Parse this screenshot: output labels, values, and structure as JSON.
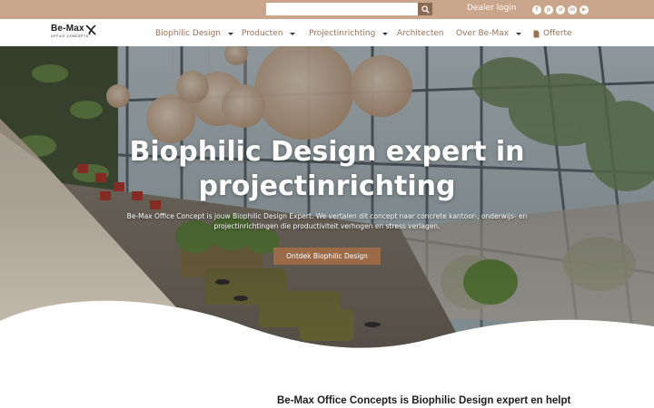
{
  "topbar": {
    "search_placeholder": "",
    "search_icon": "search-icon",
    "dealer_login": "Dealer login",
    "socials": [
      {
        "name": "facebook-icon",
        "glyph": "f"
      },
      {
        "name": "pinterest-icon",
        "glyph": "p"
      },
      {
        "name": "instagram-icon",
        "glyph": "o"
      },
      {
        "name": "linkedin-icon",
        "glyph": "in"
      },
      {
        "name": "youtube-icon",
        "glyph": "▶"
      }
    ]
  },
  "logo": {
    "name": "Be-Max",
    "sub": "OFFICE CONCEPTS"
  },
  "nav": {
    "biophilic": "Biophilic Design",
    "producten": "Producten",
    "projectinrichting": "Projectinrichting",
    "architecten": "Architecten",
    "over": "Over Be-Max",
    "offerte": "Offerte"
  },
  "hero": {
    "title_line1": "Biophilic Design expert in",
    "title_line2": "projectinrichting",
    "subtitle_line1": "Be-Max Office Concept is jouw Biophilic Design Expert. We vertalen dit concept naar concrete kantoor-, onderwijs- en",
    "subtitle_line2": "projectinrichtingen die productiviteit verhogen en stress verlagen.",
    "cta": "Ontdek Biophilic Design"
  },
  "intro": {
    "heading": "Be-Max Office Concepts is Biophilic Design expert en helpt"
  },
  "colors": {
    "topbar": "#c9a58b",
    "nav_text": "#9b7258",
    "cta": "#9b6a48"
  }
}
